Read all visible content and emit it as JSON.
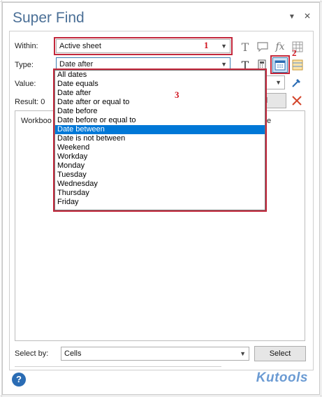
{
  "panel": {
    "title": "Super Find",
    "pin_glyph": "▾",
    "close_glyph": "✕"
  },
  "within": {
    "label": "Within:",
    "value": "Active sheet",
    "annotation": "1"
  },
  "type": {
    "label": "Type:",
    "value": "Date after",
    "annotation": "2"
  },
  "value_field": {
    "label": "Value:"
  },
  "result": {
    "label": "Result: 0",
    "header_left": "Workboo",
    "header_right": "e",
    "find_partial": "d"
  },
  "dropdown": {
    "annotation": "3",
    "options": [
      "All dates",
      "Date equals",
      "Date after",
      "Date after or equal to",
      "Date before",
      "Date before or equal to",
      "Date between",
      "Date is not between",
      "Weekend",
      "Workday",
      "Monday",
      "Tuesday",
      "Wednesday",
      "Thursday",
      "Friday"
    ],
    "selected_index": 6
  },
  "select_by": {
    "label": "Select by:",
    "value": "Cells",
    "button_label": "Select"
  },
  "footer": {
    "help_glyph": "?",
    "brand": "Kutools"
  },
  "colors": {
    "annotation_red": "#c2273b",
    "selection_blue": "#0078d7",
    "title_blue": "#4a6f96"
  }
}
